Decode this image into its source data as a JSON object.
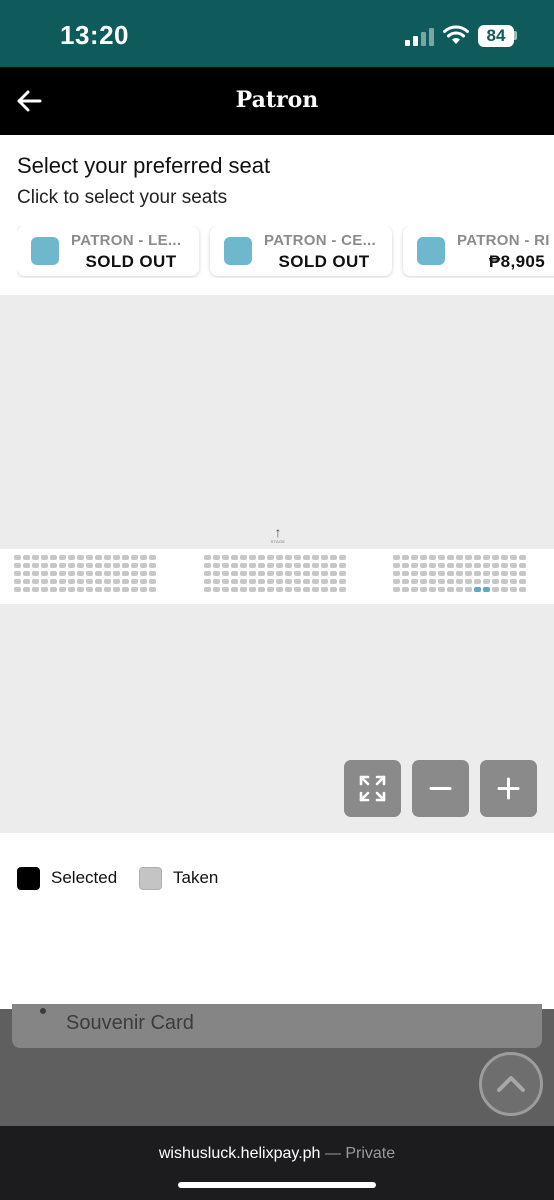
{
  "status_bar": {
    "time": "13:20",
    "battery": "84"
  },
  "header": {
    "title": "Patron"
  },
  "seat_selector": {
    "title": "Select your preferred seat",
    "subtitle": "Click to select your seats",
    "tickets": [
      {
        "name": "PATRON - LE...",
        "status": "SOLD OUT",
        "color": "#6fb7cc"
      },
      {
        "name": "PATRON - CE...",
        "status": "SOLD OUT",
        "color": "#6fb7cc"
      },
      {
        "name": "PATRON - RI",
        "status": "₱8,905",
        "color": "#6fb7cc"
      }
    ]
  },
  "seat_map": {
    "stage_label": "STAGE",
    "blocks": [
      {
        "name": "left",
        "rows": 5,
        "cols": 16,
        "selected": []
      },
      {
        "name": "center",
        "rows": 5,
        "cols": 16,
        "selected": []
      },
      {
        "name": "right",
        "rows": 5,
        "cols": 15,
        "selected": [
          [
            4,
            9
          ],
          [
            4,
            10
          ]
        ]
      }
    ],
    "controls": [
      "fullscreen-icon",
      "zoom-out-icon",
      "zoom-in-icon"
    ]
  },
  "legend": [
    {
      "label": "Selected",
      "color": "#000000"
    },
    {
      "label": "Taken",
      "color": "#c4c4c4"
    }
  ],
  "underlay": {
    "list_item": "Souvenir Card"
  },
  "browser": {
    "domain": "wishusluck.helixpay.ph",
    "separator": " — ",
    "mode": "Private"
  }
}
